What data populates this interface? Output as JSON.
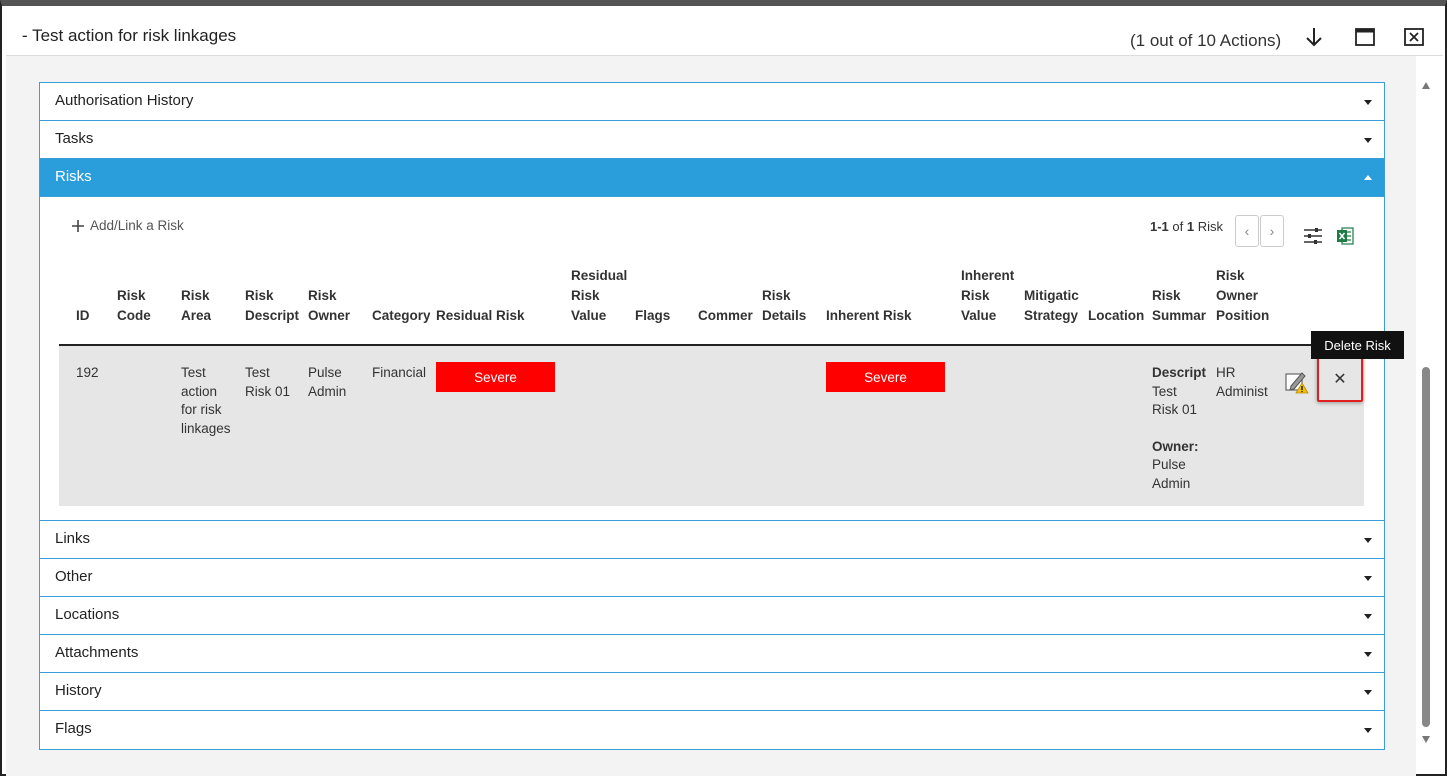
{
  "window": {
    "title": "- Test action for risk linkages",
    "counter": "(1 out of 10 Actions)"
  },
  "sections": {
    "authorisation_history": "Authorisation History",
    "tasks": "Tasks",
    "risks": "Risks",
    "links": "Links",
    "other": "Other",
    "locations": "Locations",
    "attachments": "Attachments",
    "history": "History",
    "flags": "Flags"
  },
  "risks_panel": {
    "add_link_label": "Add/Link a Risk",
    "pager": {
      "range": "1-1",
      "of": "of",
      "total": "1",
      "unit": "Risk"
    },
    "columns": {
      "id": "ID",
      "risk_code": "Risk\nCode",
      "risk_area": "Risk\nArea",
      "risk_description": "Risk\nDescript",
      "risk_owner": "Risk\nOwner",
      "category": "Category",
      "residual_risk": "Residual Risk",
      "residual_risk_value": "Residual\nRisk\nValue",
      "flags": "Flags",
      "comments": "Commer",
      "risk_details": "Risk\nDetails",
      "inherent_risk": "Inherent Risk",
      "inherent_risk_value": "Inherent\nRisk\nValue",
      "mitigation_strategy": "Mitigatic\nStrategy",
      "location": "Location",
      "risk_summary": "Risk\nSummar",
      "risk_owner_position": "Risk\nOwner\nPosition"
    },
    "row": {
      "id": "192",
      "risk_area": "Test\naction\nfor risk\nlinkages",
      "risk_description": "Test\nRisk 01",
      "risk_owner": "Pulse\nAdmin",
      "category": "Financial",
      "residual_risk": "Severe",
      "inherent_risk": "Severe",
      "summary_desc_label": "Descript",
      "summary_desc_value": "Test\nRisk 01",
      "summary_owner_label": "Owner:",
      "summary_owner_value": "Pulse\nAdmin",
      "owner_position": "HR\nAdminist"
    },
    "tooltip": "Delete Risk",
    "delete_glyph": "✕",
    "severe_color": "#ff0000"
  },
  "colors": {
    "accent": "#2a9edb",
    "border": "#3a9fd8"
  }
}
